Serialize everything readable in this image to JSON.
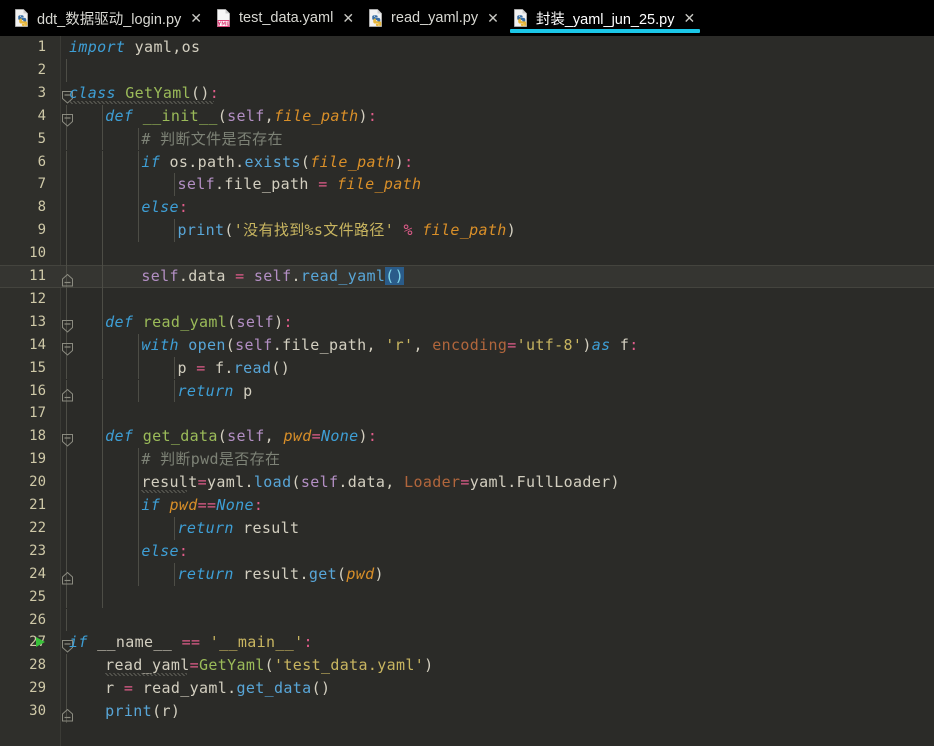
{
  "window": {
    "app": "PyCharm Editor",
    "tabbar_bg": "#000000",
    "editor_bg": "#2b2b28",
    "active_tab_accent": "#1bc7e8"
  },
  "tabs": [
    {
      "label": "ddt_数据驱动_login.py",
      "icon": "python-file-icon",
      "close_label": "✕",
      "active": false,
      "filetype": "python"
    },
    {
      "label": "test_data.yaml",
      "icon": "yaml-file-icon",
      "close_label": "✕",
      "active": false,
      "filetype": "yaml"
    },
    {
      "label": "read_yaml.py",
      "icon": "python-file-icon",
      "close_label": "✕",
      "active": false,
      "filetype": "python"
    },
    {
      "label": "封装_yaml_jun_25.py",
      "icon": "python-file-icon",
      "close_label": "✕",
      "active": true,
      "filetype": "python"
    }
  ],
  "editor": {
    "language": "Python",
    "total_lines": 30,
    "caret_line": 11,
    "highlighted_line": 11,
    "run_gutter_line": 27,
    "selection_text": "()",
    "lines": [
      {
        "n": "1",
        "text": "import yaml,os"
      },
      {
        "n": "2",
        "text": ""
      },
      {
        "n": "3",
        "text": "class GetYaml():"
      },
      {
        "n": "4",
        "text": "    def __init__(self,file_path):"
      },
      {
        "n": "5",
        "text": "        # 判断文件是否存在"
      },
      {
        "n": "6",
        "text": "        if os.path.exists(file_path):"
      },
      {
        "n": "7",
        "text": "            self.file_path = file_path"
      },
      {
        "n": "8",
        "text": "        else:"
      },
      {
        "n": "9",
        "text": "            print('没有找到%s文件路径' % file_path)"
      },
      {
        "n": "10",
        "text": ""
      },
      {
        "n": "11",
        "text": "        self.data = self.read_yaml()"
      },
      {
        "n": "12",
        "text": ""
      },
      {
        "n": "13",
        "text": "    def read_yaml(self):"
      },
      {
        "n": "14",
        "text": "        with open(self.file_path, 'r', encoding='utf-8')as f:"
      },
      {
        "n": "15",
        "text": "            p = f.read()"
      },
      {
        "n": "16",
        "text": "            return p"
      },
      {
        "n": "17",
        "text": ""
      },
      {
        "n": "18",
        "text": "    def get_data(self, pwd=None):"
      },
      {
        "n": "19",
        "text": "        # 判断pwd是否存在"
      },
      {
        "n": "20",
        "text": "        result=yaml.load(self.data, Loader=yaml.FullLoader)"
      },
      {
        "n": "21",
        "text": "        if pwd==None:"
      },
      {
        "n": "22",
        "text": "            return result"
      },
      {
        "n": "23",
        "text": "        else:"
      },
      {
        "n": "24",
        "text": "            return result.get(pwd)"
      },
      {
        "n": "25",
        "text": ""
      },
      {
        "n": "26",
        "text": ""
      },
      {
        "n": "27",
        "text": "if __name__ == '__main__':"
      },
      {
        "n": "28",
        "text": "    read_yaml=GetYaml('test_data.yaml')"
      },
      {
        "n": "29",
        "text": "    r = read_yaml.get_data()"
      },
      {
        "n": "30",
        "text": "    print(r)"
      }
    ],
    "tokens": {
      "l1": [
        [
          "kw",
          "import"
        ],
        [
          "plain",
          " yaml,os"
        ]
      ],
      "l3": [
        [
          "kw",
          "class"
        ],
        [
          "plain",
          " "
        ],
        [
          "cls",
          "GetYaml"
        ],
        [
          "pun",
          "("
        ],
        [
          "pun",
          ")"
        ],
        [
          "op",
          ":"
        ]
      ],
      "l4": [
        [
          "kw",
          "def"
        ],
        [
          "plain",
          " "
        ],
        [
          "cls",
          "__init__"
        ],
        [
          "pun",
          "("
        ],
        [
          "self",
          "self"
        ],
        [
          "pun",
          ","
        ],
        [
          "param",
          "file_path"
        ],
        [
          "pun",
          ")"
        ],
        [
          "op",
          ":"
        ]
      ],
      "l5": [
        [
          "cmt",
          "# 判断文件是否存在"
        ]
      ],
      "l6": [
        [
          "kw",
          "if"
        ],
        [
          "plain",
          " "
        ],
        [
          "plain",
          "os"
        ],
        [
          "pun",
          "."
        ],
        [
          "plain",
          "path"
        ],
        [
          "pun",
          "."
        ],
        [
          "fn",
          "exists"
        ],
        [
          "pun",
          "("
        ],
        [
          "param",
          "file_path"
        ],
        [
          "pun",
          ")"
        ],
        [
          "op",
          ":"
        ]
      ],
      "l7": [
        [
          "self",
          "self"
        ],
        [
          "pun",
          "."
        ],
        [
          "plain",
          "file_path"
        ],
        [
          "op",
          " = "
        ],
        [
          "param",
          "file_path"
        ]
      ],
      "l8": [
        [
          "kw",
          "else"
        ],
        [
          "op",
          ":"
        ]
      ],
      "l9": [
        [
          "fn",
          "print"
        ],
        [
          "pun",
          "("
        ],
        [
          "str",
          "'没有找到%s文件路径'"
        ],
        [
          "plain",
          " "
        ],
        [
          "op",
          "%"
        ],
        [
          "plain",
          " "
        ],
        [
          "param",
          "file_path"
        ],
        [
          "pun",
          ")"
        ]
      ],
      "l11": [
        [
          "self",
          "self"
        ],
        [
          "pun",
          "."
        ],
        [
          "plain",
          "data"
        ],
        [
          "op",
          " = "
        ],
        [
          "self",
          "self"
        ],
        [
          "pun",
          "."
        ],
        [
          "fn",
          "read_yaml"
        ],
        [
          "sel",
          "()"
        ]
      ],
      "l13": [
        [
          "kw",
          "def"
        ],
        [
          "plain",
          " "
        ],
        [
          "cls",
          "read_yaml"
        ],
        [
          "pun",
          "("
        ],
        [
          "self",
          "self"
        ],
        [
          "pun",
          ")"
        ],
        [
          "op",
          ":"
        ]
      ],
      "l14": [
        [
          "kw",
          "with"
        ],
        [
          "plain",
          " "
        ],
        [
          "fn",
          "open"
        ],
        [
          "pun",
          "("
        ],
        [
          "self",
          "self"
        ],
        [
          "pun",
          "."
        ],
        [
          "plain",
          "file_path"
        ],
        [
          "pun",
          ", "
        ],
        [
          "str",
          "'r'"
        ],
        [
          "pun",
          ", "
        ],
        [
          "kwarg",
          "encoding"
        ],
        [
          "op",
          "="
        ],
        [
          "str",
          "'utf-8'"
        ],
        [
          "pun",
          ")"
        ],
        [
          "kw",
          "as"
        ],
        [
          "plain",
          " f"
        ],
        [
          "op",
          ":"
        ]
      ],
      "l15": [
        [
          "plain",
          "p "
        ],
        [
          "op",
          "="
        ],
        [
          "plain",
          " f"
        ],
        [
          "pun",
          "."
        ],
        [
          "fn",
          "read"
        ],
        [
          "pun",
          "()"
        ]
      ],
      "l16": [
        [
          "kw",
          "return"
        ],
        [
          "plain",
          " p"
        ]
      ],
      "l18": [
        [
          "kw",
          "def"
        ],
        [
          "plain",
          " "
        ],
        [
          "cls",
          "get_data"
        ],
        [
          "pun",
          "("
        ],
        [
          "self",
          "self"
        ],
        [
          "pun",
          ", "
        ],
        [
          "param",
          "pwd"
        ],
        [
          "op",
          "="
        ],
        [
          "kw2i",
          "None"
        ],
        [
          "pun",
          ")"
        ],
        [
          "op",
          ":"
        ]
      ],
      "l19": [
        [
          "cmt",
          "# 判断pwd是否存在"
        ]
      ],
      "l20": [
        [
          "plain",
          "result"
        ],
        [
          "op",
          "="
        ],
        [
          "plain",
          "yaml"
        ],
        [
          "pun",
          "."
        ],
        [
          "fn",
          "load"
        ],
        [
          "pun",
          "("
        ],
        [
          "self",
          "self"
        ],
        [
          "pun",
          "."
        ],
        [
          "plain",
          "data"
        ],
        [
          "pun",
          ", "
        ],
        [
          "kwarg",
          "Loader"
        ],
        [
          "op",
          "="
        ],
        [
          "plain",
          "yaml"
        ],
        [
          "pun",
          "."
        ],
        [
          "plain",
          "FullLoader"
        ],
        [
          "pun",
          ")"
        ]
      ],
      "l21": [
        [
          "kw",
          "if"
        ],
        [
          "plain",
          " "
        ],
        [
          "param",
          "pwd"
        ],
        [
          "op",
          "=="
        ],
        [
          "kw2i",
          "None"
        ],
        [
          "op",
          ":"
        ]
      ],
      "l22": [
        [
          "kw",
          "return"
        ],
        [
          "plain",
          " result"
        ]
      ],
      "l23": [
        [
          "kw",
          "else"
        ],
        [
          "op",
          ":"
        ]
      ],
      "l24": [
        [
          "kw",
          "return"
        ],
        [
          "plain",
          " result"
        ],
        [
          "pun",
          "."
        ],
        [
          "fn",
          "get"
        ],
        [
          "pun",
          "("
        ],
        [
          "param",
          "pwd"
        ],
        [
          "pun",
          ")"
        ]
      ],
      "l27": [
        [
          "kw",
          "if"
        ],
        [
          "plain",
          " __name__ "
        ],
        [
          "op",
          "=="
        ],
        [
          "plain",
          " "
        ],
        [
          "str",
          "'__main__'"
        ],
        [
          "op",
          ":"
        ]
      ],
      "l28": [
        [
          "plain",
          "read_yaml"
        ],
        [
          "op",
          "="
        ],
        [
          "cls",
          "GetYaml"
        ],
        [
          "pun",
          "("
        ],
        [
          "str",
          "'test_data.yaml'"
        ],
        [
          "pun",
          ")"
        ]
      ],
      "l29": [
        [
          "plain",
          "r "
        ],
        [
          "op",
          "="
        ],
        [
          "plain",
          " read_yaml"
        ],
        [
          "pun",
          "."
        ],
        [
          "fn",
          "get_data"
        ],
        [
          "pun",
          "()"
        ]
      ],
      "l30": [
        [
          "fn",
          "print"
        ],
        [
          "pun",
          "("
        ],
        [
          "plain",
          "r"
        ],
        [
          "pun",
          ")"
        ]
      ]
    },
    "colors": {
      "keyword": "#3e9fd6",
      "class_name": "#9bbb59",
      "function": "#58a6d8",
      "self": "#b38fc4",
      "parameter": "#d98f28",
      "string": "#c8b560",
      "comment": "#7d8276",
      "operator": "#e05c8a",
      "kwarg": "#b1663c",
      "line_number": "#cfc9a8",
      "selection": "#2a5c8a",
      "run_marker": "#39c13a"
    }
  }
}
